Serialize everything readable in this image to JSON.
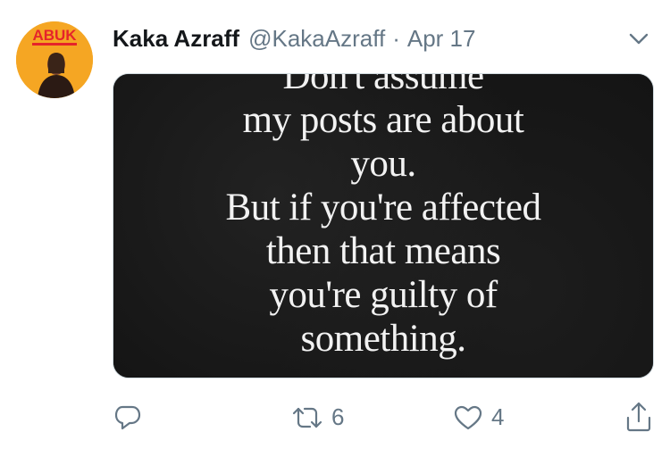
{
  "tweet": {
    "author_name": "Kaka Azraff",
    "handle": "@KakaAzraff",
    "separator": "·",
    "date": "Apr 17",
    "avatar_text": "ABUK",
    "image_lines": [
      "Don't assume",
      "my posts are about",
      "you.",
      "But if you're affected",
      "then that means",
      "you're guilty of",
      "something."
    ]
  },
  "actions": {
    "reply_count": "",
    "retweet_count": "6",
    "like_count": "4"
  },
  "icons": {
    "reply": "reply-bubble-icon",
    "retweet": "retweet-icon",
    "like": "heart-icon",
    "share": "share-icon",
    "more": "chevron-down-icon"
  },
  "colors": {
    "muted": "#657786",
    "text": "#14171a",
    "avatar_bg": "#f5a623",
    "avatar_text": "#e5242b"
  }
}
